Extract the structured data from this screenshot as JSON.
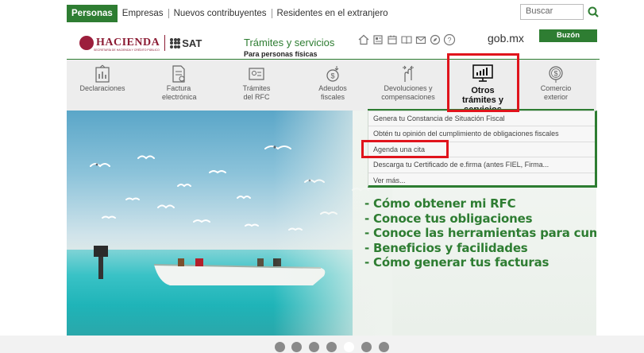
{
  "topnav": {
    "items": [
      {
        "label": "Personas",
        "active": true
      },
      {
        "label": "Empresas",
        "active": false
      },
      {
        "label": "Nuevos contribuyentes",
        "active": false
      },
      {
        "label": "Residentes en el extranjero",
        "active": false
      }
    ],
    "search_placeholder": "Buscar",
    "search_icon": "search-icon"
  },
  "header": {
    "hacienda": "HACIENDA",
    "hacienda_sub": "SECRETARÍA DE HACIENDA Y CRÉDITO PÚBLICO",
    "sat": "SAT",
    "title": "Trámites y servicios",
    "subtitle": "Para personas físicas",
    "icons": [
      "home-icon",
      "document-icon",
      "calendar-icon",
      "book-icon",
      "mail-icon",
      "compass-icon",
      "help-icon"
    ],
    "gobmx": "gob.mx",
    "buzon": "Buzón Tributario",
    "accent": "#2e7d32"
  },
  "categories": [
    {
      "label": "Declaraciones",
      "icon": "chart-upload-icon"
    },
    {
      "label": "Factura electrónica",
      "icon": "invoice-icon"
    },
    {
      "label": "Trámites del RFC",
      "icon": "id-card-icon"
    },
    {
      "label": "Adeudos fiscales",
      "icon": "coin-down-icon"
    },
    {
      "label": "Devoluciones y compensaciones",
      "icon": "hand-arrows-icon"
    },
    {
      "label": "Otros trámites y servicios",
      "icon": "monitor-chart-icon"
    },
    {
      "label": "Comercio exterior",
      "icon": "dollar-coin-icon"
    }
  ],
  "dropdown": {
    "items": [
      "Genera tu Constancia de Situación Fiscal",
      "Obtén tu opinión del cumplimiento de obligaciones fiscales",
      "Agenda una cita",
      "Descarga tu Certificado de e.firma (antes FIEL, Firma...",
      "Ver más..."
    ]
  },
  "hero": {
    "bullets": [
      "- Cómo obtener mi RFC",
      "- Conoce tus obligaciones",
      "- Conoce las herramientas para cumplir",
      "- Beneficios y facilidades",
      "- Cómo generar tus facturas"
    ]
  },
  "slider": {
    "count": 7,
    "active_index": 4
  },
  "highlight_color": "#e0141c"
}
